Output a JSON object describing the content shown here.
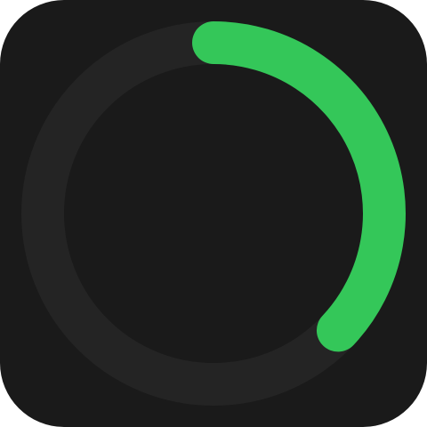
{
  "widget": {
    "type": "activity-ring",
    "progress": 0.37,
    "colors": {
      "background": "#1a1a1a",
      "track": "#242424",
      "progress": "#34c759"
    }
  }
}
